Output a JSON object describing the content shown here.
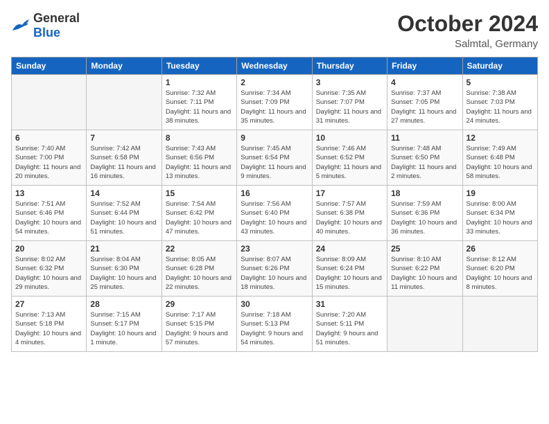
{
  "header": {
    "logo": {
      "general": "General",
      "blue": "Blue"
    },
    "title": "October 2024",
    "location": "Salmtal, Germany"
  },
  "weekdays": [
    "Sunday",
    "Monday",
    "Tuesday",
    "Wednesday",
    "Thursday",
    "Friday",
    "Saturday"
  ],
  "weeks": [
    [
      {
        "day": "",
        "sunrise": "",
        "sunset": "",
        "daylight": ""
      },
      {
        "day": "",
        "sunrise": "",
        "sunset": "",
        "daylight": ""
      },
      {
        "day": "1",
        "sunrise": "Sunrise: 7:32 AM",
        "sunset": "Sunset: 7:11 PM",
        "daylight": "Daylight: 11 hours and 38 minutes."
      },
      {
        "day": "2",
        "sunrise": "Sunrise: 7:34 AM",
        "sunset": "Sunset: 7:09 PM",
        "daylight": "Daylight: 11 hours and 35 minutes."
      },
      {
        "day": "3",
        "sunrise": "Sunrise: 7:35 AM",
        "sunset": "Sunset: 7:07 PM",
        "daylight": "Daylight: 11 hours and 31 minutes."
      },
      {
        "day": "4",
        "sunrise": "Sunrise: 7:37 AM",
        "sunset": "Sunset: 7:05 PM",
        "daylight": "Daylight: 11 hours and 27 minutes."
      },
      {
        "day": "5",
        "sunrise": "Sunrise: 7:38 AM",
        "sunset": "Sunset: 7:03 PM",
        "daylight": "Daylight: 11 hours and 24 minutes."
      }
    ],
    [
      {
        "day": "6",
        "sunrise": "Sunrise: 7:40 AM",
        "sunset": "Sunset: 7:00 PM",
        "daylight": "Daylight: 11 hours and 20 minutes."
      },
      {
        "day": "7",
        "sunrise": "Sunrise: 7:42 AM",
        "sunset": "Sunset: 6:58 PM",
        "daylight": "Daylight: 11 hours and 16 minutes."
      },
      {
        "day": "8",
        "sunrise": "Sunrise: 7:43 AM",
        "sunset": "Sunset: 6:56 PM",
        "daylight": "Daylight: 11 hours and 13 minutes."
      },
      {
        "day": "9",
        "sunrise": "Sunrise: 7:45 AM",
        "sunset": "Sunset: 6:54 PM",
        "daylight": "Daylight: 11 hours and 9 minutes."
      },
      {
        "day": "10",
        "sunrise": "Sunrise: 7:46 AM",
        "sunset": "Sunset: 6:52 PM",
        "daylight": "Daylight: 11 hours and 5 minutes."
      },
      {
        "day": "11",
        "sunrise": "Sunrise: 7:48 AM",
        "sunset": "Sunset: 6:50 PM",
        "daylight": "Daylight: 11 hours and 2 minutes."
      },
      {
        "day": "12",
        "sunrise": "Sunrise: 7:49 AM",
        "sunset": "Sunset: 6:48 PM",
        "daylight": "Daylight: 10 hours and 58 minutes."
      }
    ],
    [
      {
        "day": "13",
        "sunrise": "Sunrise: 7:51 AM",
        "sunset": "Sunset: 6:46 PM",
        "daylight": "Daylight: 10 hours and 54 minutes."
      },
      {
        "day": "14",
        "sunrise": "Sunrise: 7:52 AM",
        "sunset": "Sunset: 6:44 PM",
        "daylight": "Daylight: 10 hours and 51 minutes."
      },
      {
        "day": "15",
        "sunrise": "Sunrise: 7:54 AM",
        "sunset": "Sunset: 6:42 PM",
        "daylight": "Daylight: 10 hours and 47 minutes."
      },
      {
        "day": "16",
        "sunrise": "Sunrise: 7:56 AM",
        "sunset": "Sunset: 6:40 PM",
        "daylight": "Daylight: 10 hours and 43 minutes."
      },
      {
        "day": "17",
        "sunrise": "Sunrise: 7:57 AM",
        "sunset": "Sunset: 6:38 PM",
        "daylight": "Daylight: 10 hours and 40 minutes."
      },
      {
        "day": "18",
        "sunrise": "Sunrise: 7:59 AM",
        "sunset": "Sunset: 6:36 PM",
        "daylight": "Daylight: 10 hours and 36 minutes."
      },
      {
        "day": "19",
        "sunrise": "Sunrise: 8:00 AM",
        "sunset": "Sunset: 6:34 PM",
        "daylight": "Daylight: 10 hours and 33 minutes."
      }
    ],
    [
      {
        "day": "20",
        "sunrise": "Sunrise: 8:02 AM",
        "sunset": "Sunset: 6:32 PM",
        "daylight": "Daylight: 10 hours and 29 minutes."
      },
      {
        "day": "21",
        "sunrise": "Sunrise: 8:04 AM",
        "sunset": "Sunset: 6:30 PM",
        "daylight": "Daylight: 10 hours and 25 minutes."
      },
      {
        "day": "22",
        "sunrise": "Sunrise: 8:05 AM",
        "sunset": "Sunset: 6:28 PM",
        "daylight": "Daylight: 10 hours and 22 minutes."
      },
      {
        "day": "23",
        "sunrise": "Sunrise: 8:07 AM",
        "sunset": "Sunset: 6:26 PM",
        "daylight": "Daylight: 10 hours and 18 minutes."
      },
      {
        "day": "24",
        "sunrise": "Sunrise: 8:09 AM",
        "sunset": "Sunset: 6:24 PM",
        "daylight": "Daylight: 10 hours and 15 minutes."
      },
      {
        "day": "25",
        "sunrise": "Sunrise: 8:10 AM",
        "sunset": "Sunset: 6:22 PM",
        "daylight": "Daylight: 10 hours and 11 minutes."
      },
      {
        "day": "26",
        "sunrise": "Sunrise: 8:12 AM",
        "sunset": "Sunset: 6:20 PM",
        "daylight": "Daylight: 10 hours and 8 minutes."
      }
    ],
    [
      {
        "day": "27",
        "sunrise": "Sunrise: 7:13 AM",
        "sunset": "Sunset: 5:18 PM",
        "daylight": "Daylight: 10 hours and 4 minutes."
      },
      {
        "day": "28",
        "sunrise": "Sunrise: 7:15 AM",
        "sunset": "Sunset: 5:17 PM",
        "daylight": "Daylight: 10 hours and 1 minute."
      },
      {
        "day": "29",
        "sunrise": "Sunrise: 7:17 AM",
        "sunset": "Sunset: 5:15 PM",
        "daylight": "Daylight: 9 hours and 57 minutes."
      },
      {
        "day": "30",
        "sunrise": "Sunrise: 7:18 AM",
        "sunset": "Sunset: 5:13 PM",
        "daylight": "Daylight: 9 hours and 54 minutes."
      },
      {
        "day": "31",
        "sunrise": "Sunrise: 7:20 AM",
        "sunset": "Sunset: 5:11 PM",
        "daylight": "Daylight: 9 hours and 51 minutes."
      },
      {
        "day": "",
        "sunrise": "",
        "sunset": "",
        "daylight": ""
      },
      {
        "day": "",
        "sunrise": "",
        "sunset": "",
        "daylight": ""
      }
    ]
  ]
}
